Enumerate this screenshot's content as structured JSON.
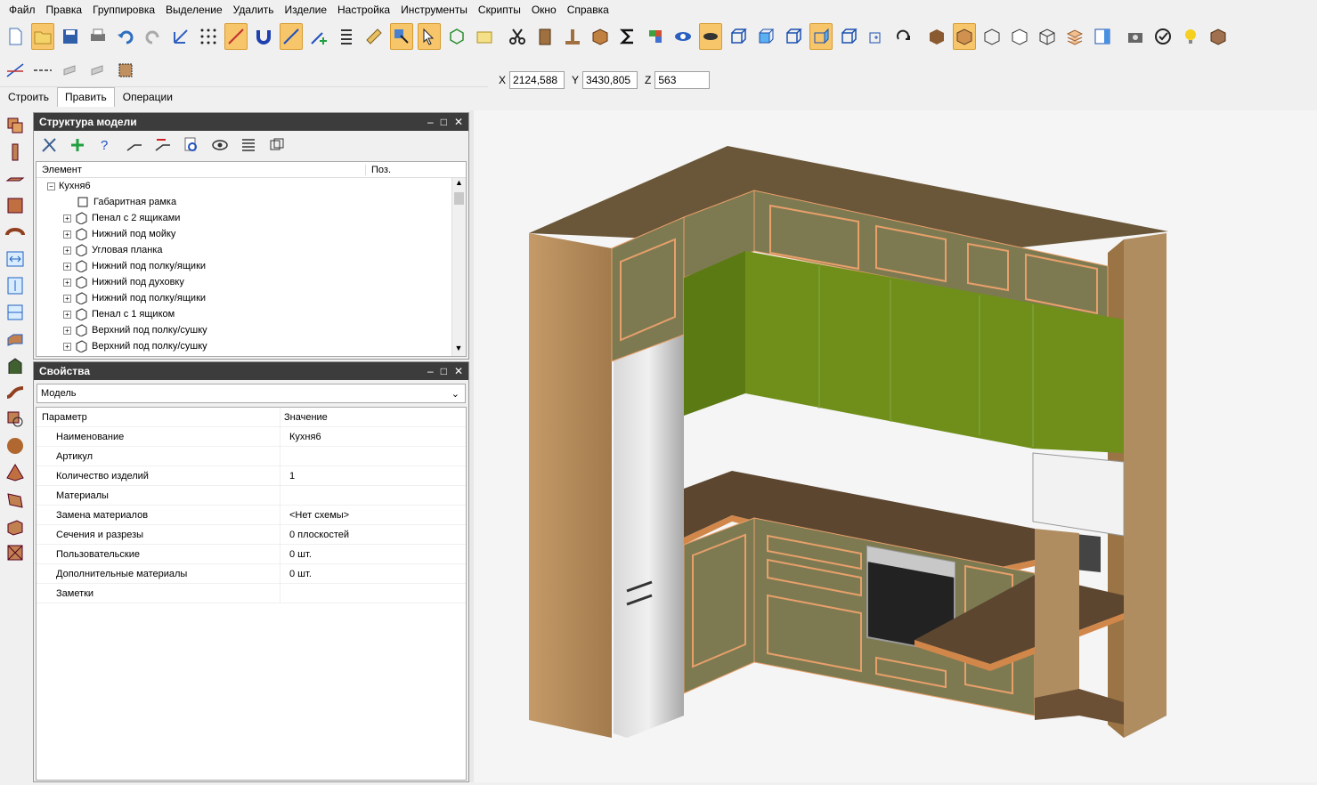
{
  "menu": [
    "Файл",
    "Правка",
    "Группировка",
    "Выделение",
    "Удалить",
    "Изделие",
    "Настройка",
    "Инструменты",
    "Скрипты",
    "Окно",
    "Справка"
  ],
  "tabs": [
    "Строить",
    "Править",
    "Операции"
  ],
  "active_tab": "Править",
  "coords": {
    "x_label": "X",
    "x": "2124,588",
    "y_label": "Y",
    "y": "3430,805",
    "z_label": "Z",
    "z": "563"
  },
  "structure": {
    "title": "Структура модели",
    "col_element": "Элемент",
    "col_pos": "Поз.",
    "root": "Кухня6",
    "items": [
      "Габаритная рамка",
      "Пенал с 2 ящиками",
      "Нижний под мойку",
      "Угловая планка",
      "Нижний под полку/ящики",
      "Нижний под духовку",
      "Нижний под полку/ящики",
      "Пенал с 1 ящиком",
      "Верхний под полку/сушку",
      "Верхний под полку/сушку"
    ]
  },
  "properties": {
    "title": "Свойства",
    "select_value": "Модель",
    "col_param": "Параметр",
    "col_value": "Значение",
    "rows": [
      {
        "k": "Наименование",
        "v": "Кухня6"
      },
      {
        "k": "Артикул",
        "v": ""
      },
      {
        "k": "Количество изделий",
        "v": "1"
      },
      {
        "k": "Материалы",
        "v": ""
      },
      {
        "k": "Замена материалов",
        "v": "<Нет схемы>"
      },
      {
        "k": "Сечения и разрезы",
        "v": "0 плоскостей"
      },
      {
        "k": "Пользовательские",
        "v": "0 шт."
      },
      {
        "k": "Дополнительные материалы",
        "v": "0 шт."
      },
      {
        "k": "Заметки",
        "v": ""
      }
    ]
  },
  "colors": {
    "wood": "#b0895a",
    "facade": "#7d7a52",
    "trim": "#e8a06a",
    "green": "#6f8f1a",
    "counter": "#5c4630"
  }
}
